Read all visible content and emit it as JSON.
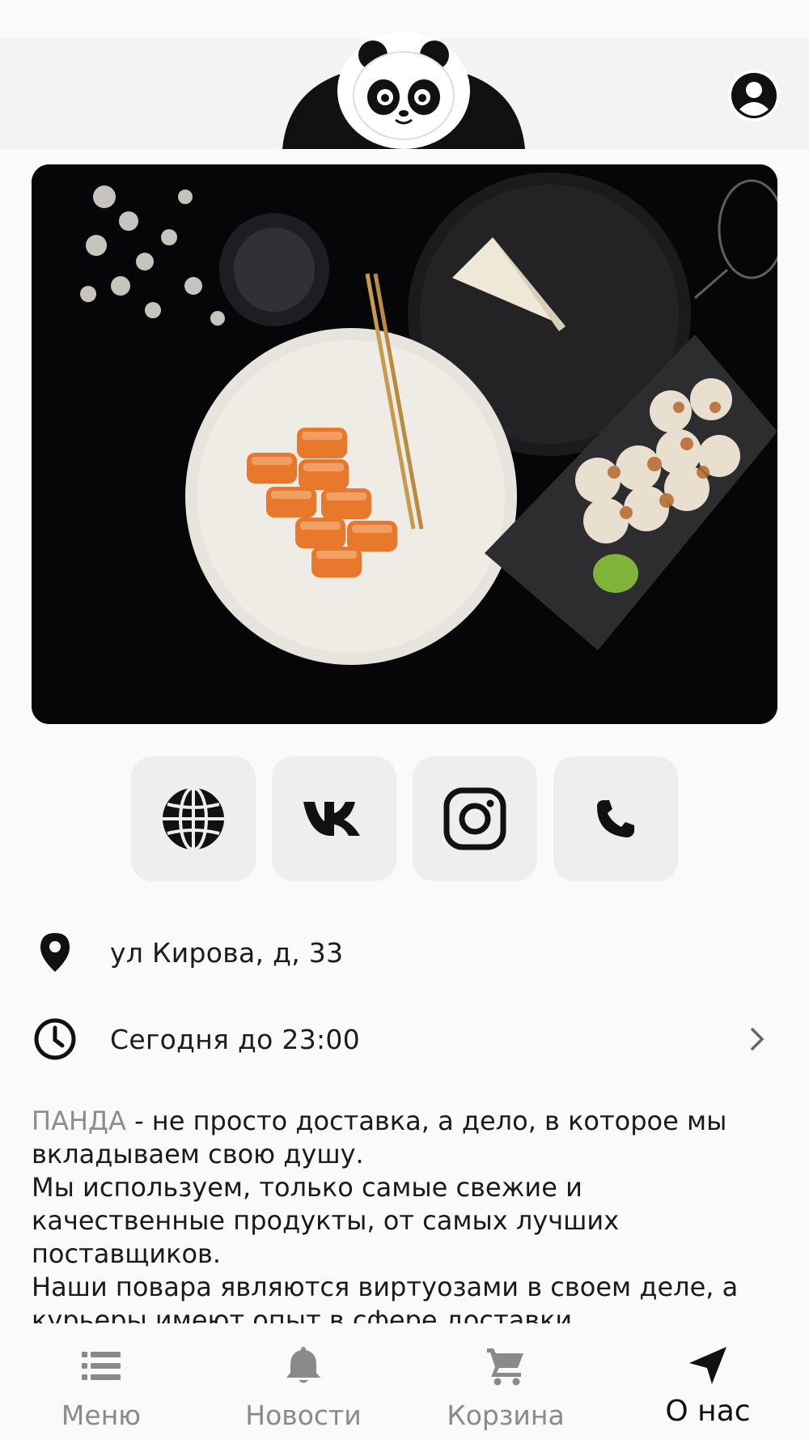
{
  "header": {
    "logo_icon": "panda-logo-icon",
    "profile_icon": "user-circle-icon"
  },
  "hero": {
    "image": "sushi-rolls-photo"
  },
  "social": [
    {
      "icon": "globe-icon"
    },
    {
      "icon": "vk-icon"
    },
    {
      "icon": "instagram-icon"
    },
    {
      "icon": "phone-icon"
    }
  ],
  "info": {
    "address": "ул Кирова, д, 33",
    "hours": "Сегодня до 23:00"
  },
  "description": {
    "brand": "ПАНДА",
    "line1_rest": " - не просто доставка, а дело, в которое мы вкладываем свою душу.",
    "line2": "Мы используем, только самые свежие и качественные продукты, от самых лучших поставщиков.",
    "line3": "Наши повара являются виртуозами в своем деле, а курьеры имеют опыт в сфере доставки."
  },
  "nav": {
    "menu": "Меню",
    "news": "Новости",
    "cart": "Корзина",
    "about": "О нас"
  },
  "colors": {
    "accent": "#111111",
    "inactive": "#8a8a8a",
    "brand_text": "#8d8d8d"
  }
}
